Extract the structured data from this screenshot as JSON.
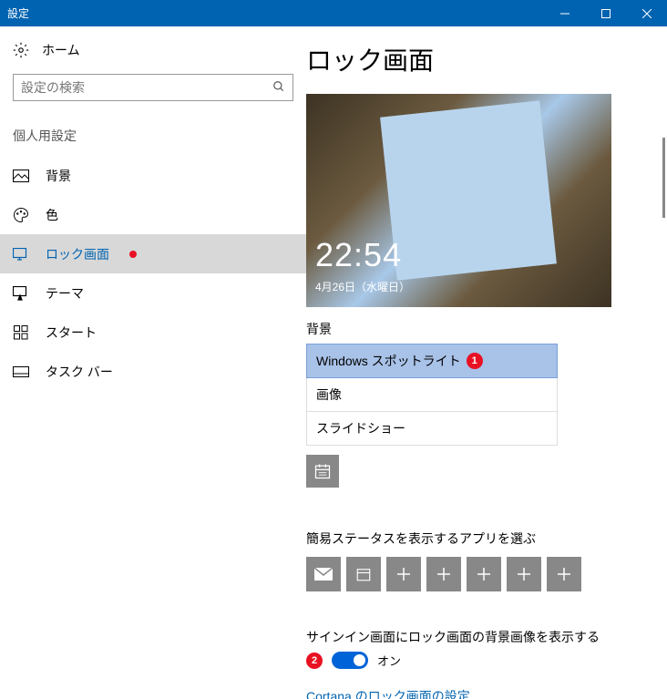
{
  "titlebar": {
    "title": "設定"
  },
  "sidebar": {
    "home": "ホーム",
    "search_placeholder": "設定の検索",
    "section": "個人用設定",
    "items": [
      {
        "label": "背景"
      },
      {
        "label": "色"
      },
      {
        "label": "ロック画面"
      },
      {
        "label": "テーマ"
      },
      {
        "label": "スタート"
      },
      {
        "label": "タスク バー"
      }
    ]
  },
  "main": {
    "title": "ロック画面",
    "preview": {
      "time": "22:54",
      "date": "4月26日（水曜日）"
    },
    "background_label": "背景",
    "background_options": [
      {
        "label": "Windows スポットライト"
      },
      {
        "label": "画像"
      },
      {
        "label": "スライドショー"
      }
    ],
    "status_apps_label": "簡易ステータスを表示するアプリを選ぶ",
    "signin_bg_label": "サインイン画面にロック画面の背景画像を表示する",
    "toggle_state": "オン",
    "cortana_link": "Cortana のロック画面の設定"
  },
  "annotations": {
    "badge1": "1",
    "badge2": "2"
  }
}
